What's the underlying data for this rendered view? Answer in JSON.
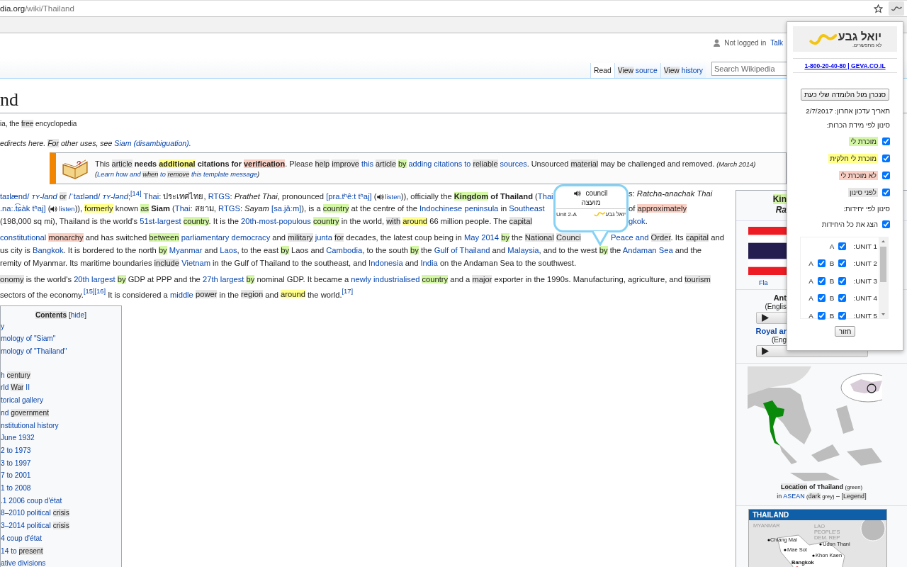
{
  "browser": {
    "url_host": "dia.org",
    "url_path": "/wiki/Thailand"
  },
  "wiki_header": {
    "personal_status": "Not logged in",
    "talk_link": "Talk",
    "tabs": [
      {
        "selected": true,
        "segments": [
          {
            "kind": "t",
            "text": "Read"
          }
        ]
      },
      {
        "selected": false,
        "segments": [
          {
            "kind": "n",
            "text": "View "
          },
          {
            "kind": "a",
            "text": "source"
          }
        ]
      },
      {
        "selected": false,
        "segments": [
          {
            "kind": "n",
            "text": "View "
          },
          {
            "kind": "a",
            "text": "history"
          }
        ]
      }
    ],
    "search": {
      "placeholder": "Search Wikipedia"
    }
  },
  "article": {
    "title": "nd",
    "tagline": [
      {
        "kind": "t",
        "text": "ia, the "
      },
      {
        "kind": "n",
        "text": "free"
      },
      {
        "kind": "t",
        "text": " encyclopedia"
      }
    ],
    "hatnote": [
      {
        "kind": "t",
        "text": "edirects here. "
      },
      {
        "kind": "n",
        "text": "For"
      },
      {
        "kind": "t",
        "text": " other uses, see "
      },
      {
        "kind": "a",
        "text": "Siam (disambiguation)"
      },
      {
        "kind": "t",
        "text": "."
      }
    ],
    "notice": [
      [
        {
          "kind": "t",
          "text": "This "
        },
        {
          "kind": "n",
          "text": "article"
        },
        {
          "kind": "t",
          "text": " **needs** "
        },
        {
          "kind": "y",
          "text": "**additional**"
        },
        {
          "kind": "t",
          "text": " **citations for** "
        },
        {
          "kind": "r",
          "text": "**verification**"
        },
        {
          "kind": "t",
          "text": ". Please "
        },
        {
          "kind": "n",
          "text": "help "
        },
        {
          "kind": "n",
          "text": "improve "
        },
        {
          "kind": "a",
          "text": "this "
        },
        {
          "kind": "n",
          "text": "article "
        },
        {
          "kind": "g",
          "text": "by "
        },
        {
          "kind": "a",
          "text": "adding citations to "
        },
        {
          "kind": "n",
          "text": "reliable "
        },
        {
          "kind": "a",
          "text": "sources"
        },
        {
          "kind": "t",
          "text": ". Unsourced "
        },
        {
          "kind": "n",
          "text": "material"
        },
        {
          "kind": "t",
          "text": " may be challenged and removed. "
        },
        {
          "kind": "small",
          "text": "*(March 2014)*"
        }
      ],
      [
        {
          "kind": "t",
          "text": "("
        },
        {
          "kind": "a",
          "text": "Learn how and "
        },
        {
          "kind": "n",
          "text": "when "
        },
        {
          "kind": "a",
          "text": "to "
        },
        {
          "kind": "n",
          "text": "remove "
        },
        {
          "kind": "a",
          "text": "this template message"
        },
        {
          "kind": "t",
          "text": ")"
        }
      ]
    ],
    "paragraphs": [
      [
        {
          "before_tooltip": [
            {
              "kind": "a",
              "text": "taɪlænd/ *ᴛʏ-land* "
            },
            {
              "kind": "n",
              "text": "or "
            },
            {
              "kind": "a",
              "text": "/ˈtaɪlənd/ *ᴛʏ-lənd*;"
            },
            {
              "kind": "a",
              "text": "$^{[14]}$ "
            },
            {
              "kind": "a",
              "text": "Thai"
            },
            {
              "kind": "t",
              "text": ": ประเทศไทย, "
            },
            {
              "kind": "a",
              "text": "RTGS"
            },
            {
              "kind": "t",
              "text": ": *Prathet Thai*, pronounced "
            },
            {
              "kind": "a",
              "text": "[pra.tʰêːt tʰaj]"
            },
            {
              "kind": "t",
              "text": " ("
            },
            {
              "kind": "listen",
              "text": "listen"
            },
            {
              "kind": "t",
              "text": ")), officially the "
            },
            {
              "kind": "g",
              "text": "**Kingdom** "
            },
            {
              "kind": "t",
              "text": "**of Thailand** ("
            },
            {
              "kind": "a",
              "text": "Thai"
            }
          ],
          "after_tooltip": [
            {
              "kind": "t",
              "text": "s: *Ratcha-anachak Thai*"
            }
          ]
        },
        {
          "before_tooltip": [
            {
              "kind": "a",
              "text": ".naː.t͡ɕàk tʰaj]"
            },
            {
              "kind": "t",
              "text": " ("
            },
            {
              "kind": "listen",
              "text": "listen"
            },
            {
              "kind": "t",
              "text": ")), "
            },
            {
              "kind": "y",
              "text": "formerly"
            },
            {
              "kind": "t",
              "text": " known "
            },
            {
              "kind": "g",
              "text": "as"
            },
            {
              "kind": "t",
              "text": " **Siam** ("
            },
            {
              "kind": "a",
              "text": "Thai"
            },
            {
              "kind": "t",
              "text": ": สยาม, "
            },
            {
              "kind": "a",
              "text": "RTGS"
            },
            {
              "kind": "t",
              "text": ": *Sayam* "
            },
            {
              "kind": "a",
              "text": "[sa.jǎːm]"
            },
            {
              "kind": "t",
              "text": "), is a "
            },
            {
              "kind": "g",
              "text": "country"
            },
            {
              "kind": "t",
              "text": " at the centre of the "
            },
            {
              "kind": "a",
              "text": "Indochinese peninsula"
            },
            {
              "kind": "t",
              "text": " in "
            },
            {
              "kind": "a",
              "text": "Southeast"
            }
          ],
          "after_tooltip": [
            {
              "kind": "t",
              "text": "of "
            },
            {
              "kind": "r",
              "text": "approximately"
            }
          ]
        },
        {
          "before_tooltip": [
            {
              "kind": "t",
              "text": "(198,000 sq mi), Thailand is the world's "
            },
            {
              "kind": "a",
              "text": "51st-largest "
            },
            {
              "kind": "g",
              "text": "country"
            },
            {
              "kind": "t",
              "text": ". It is the "
            },
            {
              "kind": "a",
              "text": "20th-most-populous "
            },
            {
              "kind": "g",
              "text": "country"
            },
            {
              "kind": "t",
              "text": " in the world, "
            },
            {
              "kind": "n",
              "text": "with "
            },
            {
              "kind": "y",
              "text": "around"
            },
            {
              "kind": "t",
              "text": " 66 million people. The "
            },
            {
              "kind": "n",
              "text": "capital"
            }
          ],
          "after_tooltip": [
            {
              "kind": "a",
              "text": "gkok"
            },
            {
              "kind": "t",
              "text": "."
            }
          ]
        }
      ],
      [
        {
          "before_pointer": [
            {
              "kind": "a",
              "text": "constitutional "
            },
            {
              "kind": "r",
              "text": "monarchy"
            },
            {
              "kind": "t",
              "text": " and has switched "
            },
            {
              "kind": "g",
              "text": "between "
            },
            {
              "kind": "a",
              "text": "parliamentary democracy"
            },
            {
              "kind": "t",
              "text": " and "
            },
            {
              "kind": "n",
              "text": "military "
            },
            {
              "kind": "a",
              "text": "junta "
            },
            {
              "kind": "n",
              "text": "for"
            },
            {
              "kind": "t",
              "text": " decades, the latest coup being in "
            },
            {
              "kind": "a",
              "text": "May 2014 "
            },
            {
              "kind": "g",
              "text": "by"
            },
            {
              "kind": "t",
              "text": " the "
            },
            {
              "kind": "n",
              "text": "National "
            },
            {
              "kind": "n",
              "text": "Counci"
            }
          ],
          "after_pointer": [
            {
              "kind": "a",
              "text": "Peace and "
            },
            {
              "kind": "n",
              "text": "Order"
            },
            {
              "kind": "t",
              "text": ". Its "
            },
            {
              "kind": "n",
              "text": "capital"
            },
            {
              "kind": "t",
              "text": " and"
            }
          ]
        },
        {
          "segments": [
            {
              "kind": "t",
              "text": "us city is "
            },
            {
              "kind": "a",
              "text": "Bangkok"
            },
            {
              "kind": "t",
              "text": ". It is bordered to the north "
            },
            {
              "kind": "g",
              "text": "by "
            },
            {
              "kind": "a",
              "text": "Myanmar"
            },
            {
              "kind": "t",
              "text": " and "
            },
            {
              "kind": "a",
              "text": "Laos"
            },
            {
              "kind": "t",
              "text": ", to the east "
            },
            {
              "kind": "g",
              "text": "by"
            },
            {
              "kind": "t",
              "text": " Laos and "
            },
            {
              "kind": "a",
              "text": "Cambodia"
            },
            {
              "kind": "t",
              "text": ", to the south "
            },
            {
              "kind": "g",
              "text": "by"
            },
            {
              "kind": "t",
              "text": " the "
            },
            {
              "kind": "a",
              "text": "Gulf of Thailand"
            },
            {
              "kind": "t",
              "text": " and "
            },
            {
              "kind": "a",
              "text": "Malaysia"
            },
            {
              "kind": "t",
              "text": ", and to the west "
            },
            {
              "kind": "g",
              "text": "by"
            },
            {
              "kind": "t",
              "text": " the "
            },
            {
              "kind": "a",
              "text": "Andaman Sea"
            },
            {
              "kind": "t",
              "text": " and the"
            }
          ]
        },
        {
          "segments": [
            {
              "kind": "t",
              "text": "remity of Myanmar. Its maritime boundaries "
            },
            {
              "kind": "n",
              "text": "include "
            },
            {
              "kind": "a",
              "text": "Vietnam"
            },
            {
              "kind": "t",
              "text": " in the Gulf of Thailand to the southeast, and "
            },
            {
              "kind": "a",
              "text": "Indonesia"
            },
            {
              "kind": "t",
              "text": " and "
            },
            {
              "kind": "a",
              "text": "India"
            },
            {
              "kind": "t",
              "text": " on the Andaman Sea to the southwest."
            }
          ]
        }
      ],
      [
        {
          "segments": [
            {
              "kind": "n",
              "text": "onomy"
            },
            {
              "kind": "t",
              "text": " is the world's "
            },
            {
              "kind": "a",
              "text": "20th largest "
            },
            {
              "kind": "g",
              "text": "by"
            },
            {
              "kind": "t",
              "text": " GDP at PPP and the "
            },
            {
              "kind": "a",
              "text": "27th largest "
            },
            {
              "kind": "g",
              "text": "by"
            },
            {
              "kind": "t",
              "text": " nominal GDP. It became a "
            },
            {
              "kind": "a",
              "text": "newly industrialised "
            },
            {
              "kind": "g",
              "text": "country"
            },
            {
              "kind": "t",
              "text": " and a "
            },
            {
              "kind": "n",
              "text": "major"
            },
            {
              "kind": "t",
              "text": " exporter in the 1990s. Manufacturing, agriculture, and "
            },
            {
              "kind": "n",
              "text": "tourism"
            }
          ]
        },
        {
          "segments": [
            {
              "kind": "t",
              "text": "sectors of the economy."
            },
            {
              "kind": "a",
              "text": "$^{[15][16]}$"
            },
            {
              "kind": "t",
              "text": " It is considered a "
            },
            {
              "kind": "a",
              "text": "middle "
            },
            {
              "kind": "n",
              "text": "power"
            },
            {
              "kind": "t",
              "text": " in the "
            },
            {
              "kind": "n",
              "text": "region"
            },
            {
              "kind": "t",
              "text": " and "
            },
            {
              "kind": "y",
              "text": "around"
            },
            {
              "kind": "t",
              "text": " the world."
            },
            {
              "kind": "a",
              "text": "$^{[17]}$"
            }
          ]
        }
      ]
    ],
    "contents": {
      "heading": "Contents",
      "toggle": [
        {
          "kind": "t",
          "text": "["
        },
        {
          "kind": "a",
          "text": "hide"
        },
        {
          "kind": "t",
          "text": "]"
        }
      ],
      "groups": [
        [
          [
            {
              "kind": "a",
              "text": "y"
            }
          ],
          [
            {
              "kind": "a",
              "text": "mology of \"Siam\""
            }
          ],
          [
            {
              "kind": "a",
              "text": "mology of \"Thailand\""
            }
          ]
        ],
        [
          [
            {
              "kind": "a",
              "text": "h "
            },
            {
              "kind": "n",
              "text": "century"
            }
          ],
          [
            {
              "kind": "a",
              "text": "rld "
            },
            {
              "kind": "n",
              "text": "War"
            },
            {
              "kind": "a",
              "text": " II"
            }
          ],
          [
            {
              "kind": "a",
              "text": "torical gallery"
            }
          ],
          [
            {
              "kind": "a",
              "text": "nd "
            },
            {
              "kind": "n",
              "text": "government"
            }
          ],
          [
            {
              "kind": "a",
              "text": "nstitutional history"
            }
          ],
          [
            {
              "kind": "a",
              "text": "June 1932"
            }
          ],
          [
            {
              "kind": "a",
              "text": "2 to 1973"
            }
          ],
          [
            {
              "kind": "a",
              "text": "3 to 1997"
            }
          ],
          [
            {
              "kind": "a",
              "text": "7 to 2001"
            }
          ],
          [
            {
              "kind": "a",
              "text": "1 to 2008"
            }
          ],
          [
            {
              "kind": "a",
              "text": ".1  2006 coup d'état"
            }
          ],
          [
            {
              "kind": "a",
              "text": "8–2010 political "
            },
            {
              "kind": "n",
              "text": "crisis"
            }
          ],
          [
            {
              "kind": "a",
              "text": "3–2014 political "
            },
            {
              "kind": "n",
              "text": "crisis"
            }
          ],
          [
            {
              "kind": "a",
              "text": "4 coup d'état"
            }
          ],
          [
            {
              "kind": "a",
              "text": "14 to "
            },
            {
              "kind": "n",
              "text": "present"
            }
          ],
          [
            {
              "kind": "a",
              "text": "ative divisions"
            }
          ]
        ]
      ]
    }
  },
  "tooltip": {
    "word": "council",
    "translation": "מועצה",
    "unit": "Unit 2-A",
    "brand": "יואל גבע"
  },
  "infobox": {
    "title_lines": [
      [
        {
          "kind": "g",
          "text": "Kin"
        }
      ],
      [
        {
          "kind": "t",
          "text": "*Ra*"
        }
      ]
    ],
    "flag_caption": "Fla",
    "anthems": [
      {
        "title": "Ant",
        "title_is_link": false,
        "language": "(Englis"
      },
      {
        "title": "Royal ar",
        "title_is_link": true,
        "language": "(Eng"
      }
    ],
    "map_caption": [
      [
        {
          "kind": "n",
          "text": "**Location**"
        },
        {
          "kind": "t",
          "text": " **of Thailand** "
        },
        {
          "kind": "small",
          "text": "(green)"
        }
      ],
      [
        {
          "kind": "t",
          "text": "in "
        },
        {
          "kind": "a",
          "text": "ASEAN"
        },
        {
          "kind": "small",
          "text": " ("
        },
        {
          "kind": "n",
          "text": "dark"
        },
        {
          "kind": "small",
          "text": " grey)"
        },
        {
          "kind": "t",
          "text": " – ["
        },
        {
          "kind": "n",
          "text": "Legend"
        },
        {
          "kind": "t",
          "text": "]"
        }
      ]
    ],
    "location_map": {
      "title": "THAILAND",
      "labels": [
        {
          "kind": "country",
          "text": "MYANMAR"
        },
        {
          "kind": "country",
          "text": "LAO PEOPLE'S DEM. REP"
        },
        {
          "kind": "city",
          "text": "Chiang Mai"
        },
        {
          "kind": "city",
          "text": "Udon Thani"
        },
        {
          "kind": "city",
          "text": "Mae Sot"
        },
        {
          "kind": "city",
          "text": "Khon Kaen"
        },
        {
          "kind": "capital",
          "text": "Bangkok"
        }
      ]
    }
  },
  "popup": {
    "logo_name": "יואל גבע",
    "logo_tagline": "לא מתפשרים.",
    "contact_link": "1-800-20-40-80 | GEVA.CO.IL",
    "sync_button": "סנכרן מול הלומדה שלי כעת",
    "last_update": "תאריך עדכון אחרון: 2/7/2017",
    "familiarity_heading": "סינון לפי מידת הכרות:",
    "familiarity_filters": [
      {
        "label": "מוכרת לי",
        "checked": true,
        "color": "#d4f7a6"
      },
      {
        "label": "מוכרת לי חלקית",
        "checked": true,
        "color": "#ffff8a"
      },
      {
        "label": "לא מוכרת לי",
        "checked": true,
        "color": "#f9cfc4"
      },
      {
        "label": "לפני סינון",
        "checked": true,
        "color": "#e6e6e6"
      }
    ],
    "units_heading": "סינון לפי יחידות:",
    "show_all": {
      "label": "הצג את כל היחידות",
      "checked": true
    },
    "units": [
      {
        "label": "UNIT 1:",
        "parts": [
          {
            "label": "A",
            "checked": true
          }
        ]
      },
      {
        "label": "UNIT 2:",
        "parts": [
          {
            "label": "A",
            "checked": true
          },
          {
            "label": "B",
            "checked": true
          }
        ]
      },
      {
        "label": "UNIT 3:",
        "parts": [
          {
            "label": "A",
            "checked": true
          },
          {
            "label": "B",
            "checked": true
          }
        ]
      },
      {
        "label": "UNIT 4:",
        "parts": [
          {
            "label": "A",
            "checked": true
          },
          {
            "label": "B",
            "checked": true
          }
        ]
      },
      {
        "label": "UNIT 5:",
        "parts": [
          {
            "label": "A",
            "checked": true
          },
          {
            "label": "B",
            "checked": true
          }
        ]
      }
    ],
    "back_button": "חזור"
  }
}
